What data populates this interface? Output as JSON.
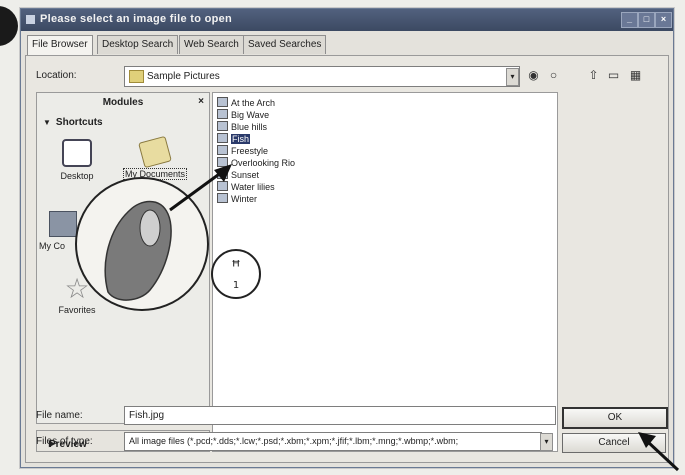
{
  "window": {
    "title": "Please select an image file to open"
  },
  "tabs": [
    {
      "label": "File Browser"
    },
    {
      "label": "Desktop Search"
    },
    {
      "label": "Web Search"
    },
    {
      "label": "Saved Searches"
    }
  ],
  "location": {
    "label": "Location:",
    "value": "Sample Pictures"
  },
  "modules": {
    "title": "Modules",
    "close": "×",
    "shortcuts_label": "Shortcuts",
    "items": [
      {
        "label": "Desktop"
      },
      {
        "label": "My Documents"
      },
      {
        "label": "My Co"
      },
      {
        "label": "Favorites"
      }
    ],
    "preview_label": "Preview"
  },
  "files": [
    {
      "name": "At the Arch"
    },
    {
      "name": "Big Wave"
    },
    {
      "name": "Blue hills"
    },
    {
      "name": "Fish"
    },
    {
      "name": "Freestyle"
    },
    {
      "name": "Overlooking Rio"
    },
    {
      "name": "Sunset"
    },
    {
      "name": "Water lilies"
    },
    {
      "name": "Winter"
    }
  ],
  "selected_file": "Fish",
  "file_name": {
    "label": "File name:",
    "value": "Fish.jpg"
  },
  "file_type": {
    "label": "Files of type:",
    "value": "All image files (*.pcd;*.dds;*.lcw;*.psd;*.xbm;*.xpm;*.jfif;*.lbm;*.mng;*.wbmp;*.wbm;"
  },
  "buttons": {
    "ok": "OK",
    "cancel": "Cancel"
  },
  "icons": [
    "step-badge",
    "window-icon",
    "folder-icon",
    "back-icon",
    "forward-icon",
    "up-folder-icon",
    "new-folder-icon",
    "view-menu-icon",
    "desktop-icon",
    "documents-icon",
    "computer-icon",
    "favorites-star-icon",
    "file-image-icon",
    "mouse-click-callout",
    "double-click-callout",
    "arrow-pointer"
  ],
  "colors": {
    "titlebar": "#43506a",
    "selection": "#2a3a6a"
  }
}
